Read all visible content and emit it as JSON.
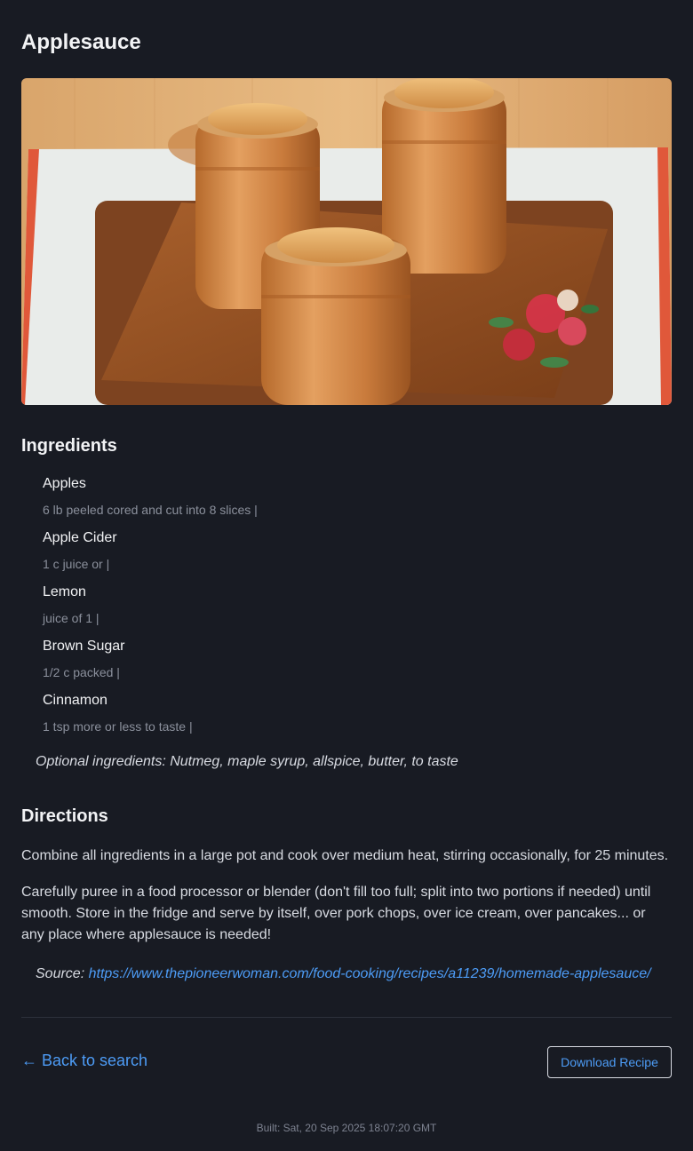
{
  "recipe": {
    "title": "Applesauce",
    "image_alt": "Three jars of applesauce on a wooden cutting board"
  },
  "ingredients": {
    "heading": "Ingredients",
    "items": [
      {
        "name": "Apples",
        "amount": "6 lb peeled cored and cut into 8 slices |"
      },
      {
        "name": "Apple Cider",
        "amount": "1 c juice or |"
      },
      {
        "name": "Lemon",
        "amount": "juice of 1 |"
      },
      {
        "name": "Brown Sugar",
        "amount": "1/2 c packed |"
      },
      {
        "name": "Cinnamon",
        "amount": "1 tsp more or less to taste |"
      }
    ],
    "optional": "Optional ingredients: Nutmeg, maple syrup, allspice, butter, to taste"
  },
  "directions": {
    "heading": "Directions",
    "steps": [
      "Combine all ingredients in a large pot and cook over medium heat, stirring occasionally, for 25 minutes.",
      "Carefully puree in a food processor or blender (don't fill too full; split into two portions if needed) until smooth. Store in the fridge and serve by itself, over pork chops, over ice cream, over pancakes... or any place where applesauce is needed!"
    ]
  },
  "source": {
    "label": "Source:",
    "url": "https://www.thepioneerwoman.com/food-cooking/recipes/a11239/homemade-applesauce/"
  },
  "actions": {
    "back_label": "← Back to search",
    "download_label": "Download Recipe"
  },
  "footer": {
    "built": "Built: Sat, 20 Sep 2025 18:07:20 GMT"
  },
  "colors": {
    "background": "#181b23",
    "link": "#4d9cf6",
    "muted": "#8b909c"
  }
}
